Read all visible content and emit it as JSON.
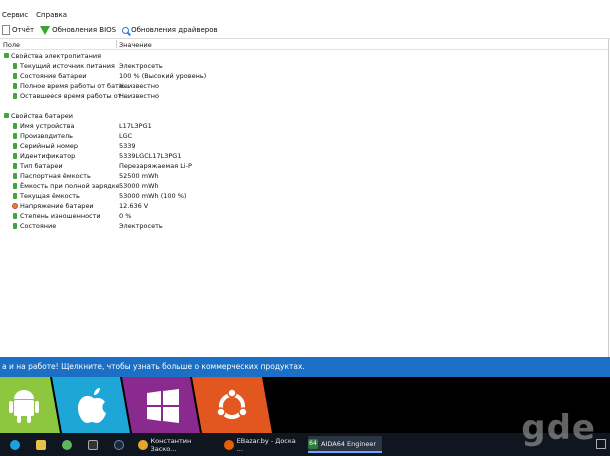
{
  "menu": {
    "items": [
      "Сервис",
      "Справка"
    ]
  },
  "toolbar": {
    "report": "Отчёт",
    "bios_updates": "Обновления BIOS",
    "driver_updates": "Обновления драйверов"
  },
  "columns": {
    "field": "Поле",
    "value": "Значение"
  },
  "sections": [
    {
      "title": "Свойства электропитания",
      "rows": [
        {
          "label": "Текущий источник питания",
          "value": "Электросеть"
        },
        {
          "label": "Состояние батареи",
          "value": "100 % (Высокий уровень)"
        },
        {
          "label": "Полное время работы от бата...",
          "value": "Неизвестно"
        },
        {
          "label": "Оставшееся время работы от ...",
          "value": "Неизвестно"
        }
      ]
    },
    {
      "title": "Свойства батареи",
      "rows": [
        {
          "label": "Имя устройства",
          "value": "L17L3PG1"
        },
        {
          "label": "Производитель",
          "value": "LGC"
        },
        {
          "label": "Серийный номер",
          "value": "5339"
        },
        {
          "label": "Идентификатор",
          "value": "5339LGCL17L3PG1"
        },
        {
          "label": "Тип батареи",
          "value": "Перезаряжаемая Li-P"
        },
        {
          "label": "Паспортная ёмкость",
          "value": "52500 mWh"
        },
        {
          "label": "Ёмкость при полной зарядке",
          "value": "53000 mWh"
        },
        {
          "label": "Текущая ёмкость",
          "value": "53000 mWh  (100 %)"
        },
        {
          "label": "Напряжение батареи",
          "value": "12.636 V"
        },
        {
          "label": "Степень изношенности",
          "value": "0 %"
        },
        {
          "label": "Состояние",
          "value": "Электросеть"
        }
      ]
    }
  ],
  "banner": {
    "text": "а и на работе! Щелкните, чтобы узнать больше о коммерческих продуктах."
  },
  "tiles": {
    "colors": [
      "#8dc63f",
      "#1ea7d6",
      "#8b2a8e",
      "#e2561f"
    ],
    "icons": [
      "android-icon",
      "apple-icon",
      "windows-icon",
      "ubuntu-icon"
    ]
  },
  "taskbar": {
    "items": [
      {
        "label": "",
        "icon": "skype-icon",
        "color": "#1aa0e3"
      },
      {
        "label": "",
        "icon": "folder-icon",
        "color": "#e8c14a"
      },
      {
        "label": "",
        "icon": "recycle-icon",
        "color": "#5cb85c"
      },
      {
        "label": "",
        "icon": "terminal-icon",
        "color": "#333"
      },
      {
        "label": "",
        "icon": "steam-icon",
        "color": "#1b2838"
      },
      {
        "label": "Константин Заско...",
        "icon": "chrome-icon",
        "color": "#e5a52b"
      },
      {
        "label": "EBazar.by - Доска ...",
        "icon": "firefox-icon",
        "color": "#e66000"
      },
      {
        "label": "AIDA64 Engineer",
        "icon": "aida64-icon",
        "color": "#2d7a3a"
      }
    ]
  },
  "watermark": "gde"
}
